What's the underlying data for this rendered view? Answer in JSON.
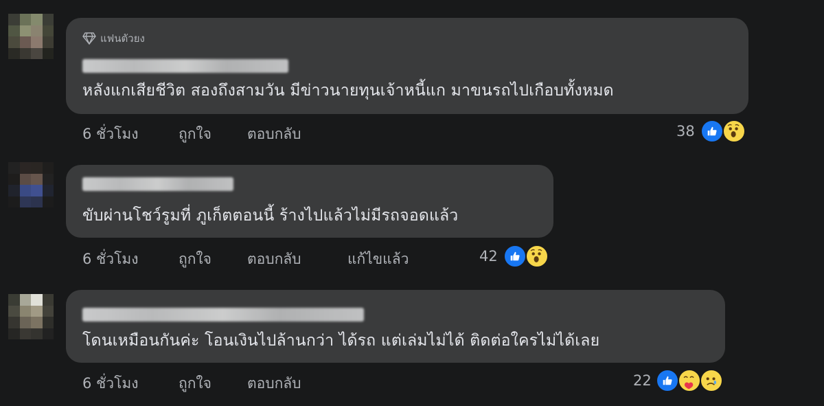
{
  "comments": [
    {
      "badge": "แฟนตัวยง",
      "text": "หลังแกเสียชีวิต สองถึงสามวัน มีข่าวนายทุนเจ้าหนี้แก มาขนรถไปเกือบทั้งหมด",
      "time": "6 ชั่วโมง",
      "like": "ถูกใจ",
      "reply": "ตอบกลับ",
      "edited": "",
      "count": "38",
      "reactions": [
        "like-icon",
        "wow-icon"
      ]
    },
    {
      "badge": "",
      "text": "ขับผ่านโชว์รูมที่ ภูเก็ตตอนนี้ ร้างไปแล้วไม่มีรถจอดแล้ว",
      "time": "6 ชั่วโมง",
      "like": "ถูกใจ",
      "reply": "ตอบกลับ",
      "edited": "แก้ไขแล้ว",
      "count": "42",
      "reactions": [
        "like-icon",
        "wow-icon"
      ]
    },
    {
      "badge": "",
      "text": "โดนเหมือนกันค่ะ โอนเงินไปล้านกว่า ได้รถ แต่เล่มไม่ได้ ติดต่อใครไม่ได้เลย",
      "time": "6 ชั่วโมง",
      "like": "ถูกใจ",
      "reply": "ตอบกลับ",
      "edited": "",
      "count": "22",
      "reactions": [
        "like-icon",
        "care-icon",
        "sad-icon"
      ]
    }
  ],
  "colors": {
    "background": "#18191a",
    "bubble": "#3a3b3c",
    "text": "#e4e6eb",
    "muted": "#b0b3b8",
    "like_blue": "#1877f2",
    "emoji_yellow": "#f7d64a"
  }
}
